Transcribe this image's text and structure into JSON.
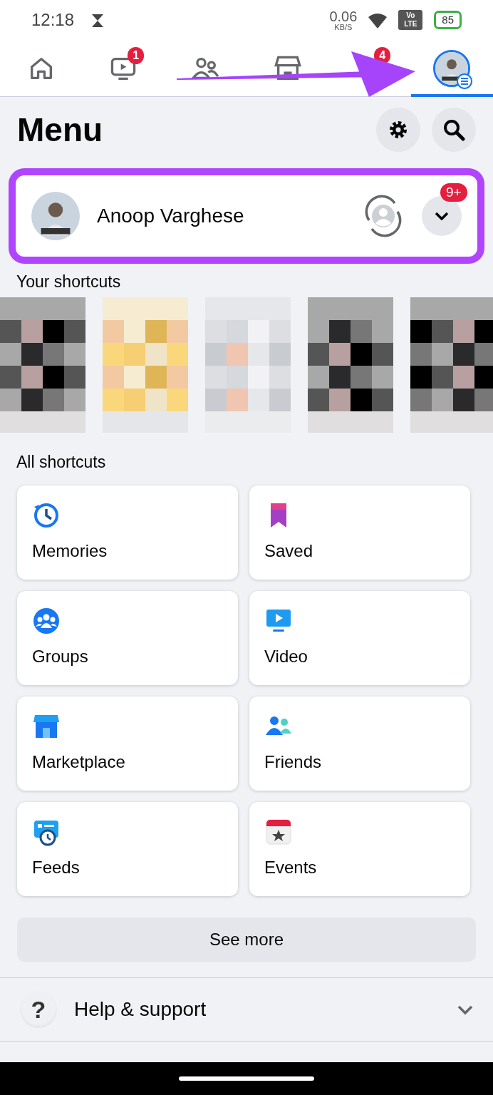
{
  "status_bar": {
    "time": "12:18",
    "speed": "0.06",
    "speed_unit": "KB/S",
    "network": "Vo LTE",
    "battery": "85"
  },
  "tabs": [
    {
      "kind": "home",
      "selected": false
    },
    {
      "kind": "video",
      "badge": "1",
      "selected": false
    },
    {
      "kind": "friends",
      "selected": false
    },
    {
      "kind": "marketplace",
      "selected": false
    },
    {
      "kind": "notifications",
      "badge": "4",
      "selected": false
    },
    {
      "kind": "profile",
      "selected": true
    }
  ],
  "header": {
    "title": "Menu"
  },
  "profile": {
    "name": "Anoop Varghese",
    "badge": "9+"
  },
  "your_shortcuts": {
    "title": "Your shortcuts"
  },
  "all_shortcuts": {
    "title": "All shortcuts",
    "items": [
      {
        "kind": "memories",
        "label": "Memories"
      },
      {
        "kind": "saved",
        "label": "Saved"
      },
      {
        "kind": "groups",
        "label": "Groups"
      },
      {
        "kind": "video",
        "label": "Video"
      },
      {
        "kind": "marketplace",
        "label": "Marketplace"
      },
      {
        "kind": "friends",
        "label": "Friends"
      },
      {
        "kind": "feeds",
        "label": "Feeds"
      },
      {
        "kind": "events",
        "label": "Events"
      }
    ]
  },
  "see_more": "See more",
  "help": {
    "icon": "?",
    "label": "Help & support",
    "expanded": false
  },
  "annotations": {
    "arrow": true,
    "frame": true
  }
}
